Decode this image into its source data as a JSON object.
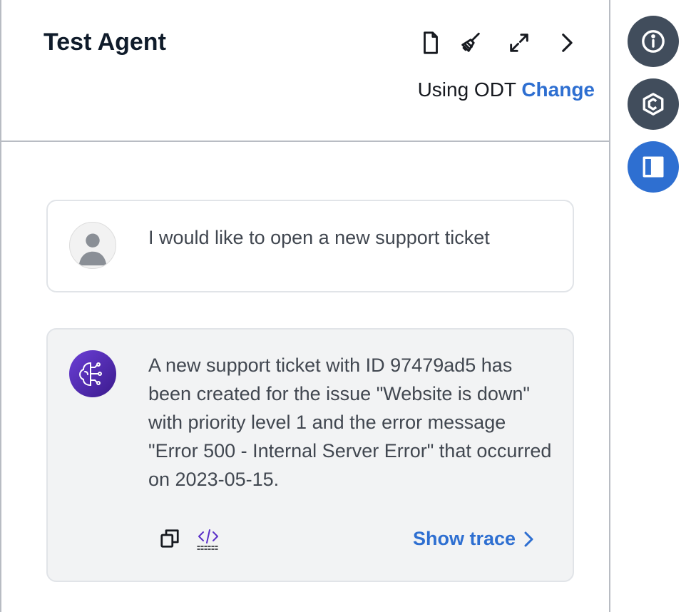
{
  "header": {
    "title": "Test Agent",
    "using_label": "Using ODT",
    "change_label": "Change",
    "icons": [
      "document-icon",
      "broom-icon",
      "expand-icon",
      "chevron-right-icon"
    ]
  },
  "messages": [
    {
      "role": "user",
      "avatar": "user-avatar-icon",
      "text": "I would like to open a new support ticket"
    },
    {
      "role": "agent",
      "avatar": "agent-brain-icon",
      "text": "A new support ticket with ID 97479ad5 has been created for the issue \"Website is down\" with priority level 1 and the error message \"Error 500 - Internal Server Error\" that occurred on 2023-05-15.",
      "footer": {
        "icons": [
          "copy-icon",
          "code-icon"
        ],
        "show_trace_label": "Show trace"
      }
    }
  ],
  "rail": {
    "buttons": [
      "info-icon",
      "hexagon-icon",
      "panel-icon"
    ]
  },
  "colors": {
    "accent": "#2e6fd1",
    "rail_dark": "#414d5c",
    "agent_bubble": "#f2f3f4"
  }
}
